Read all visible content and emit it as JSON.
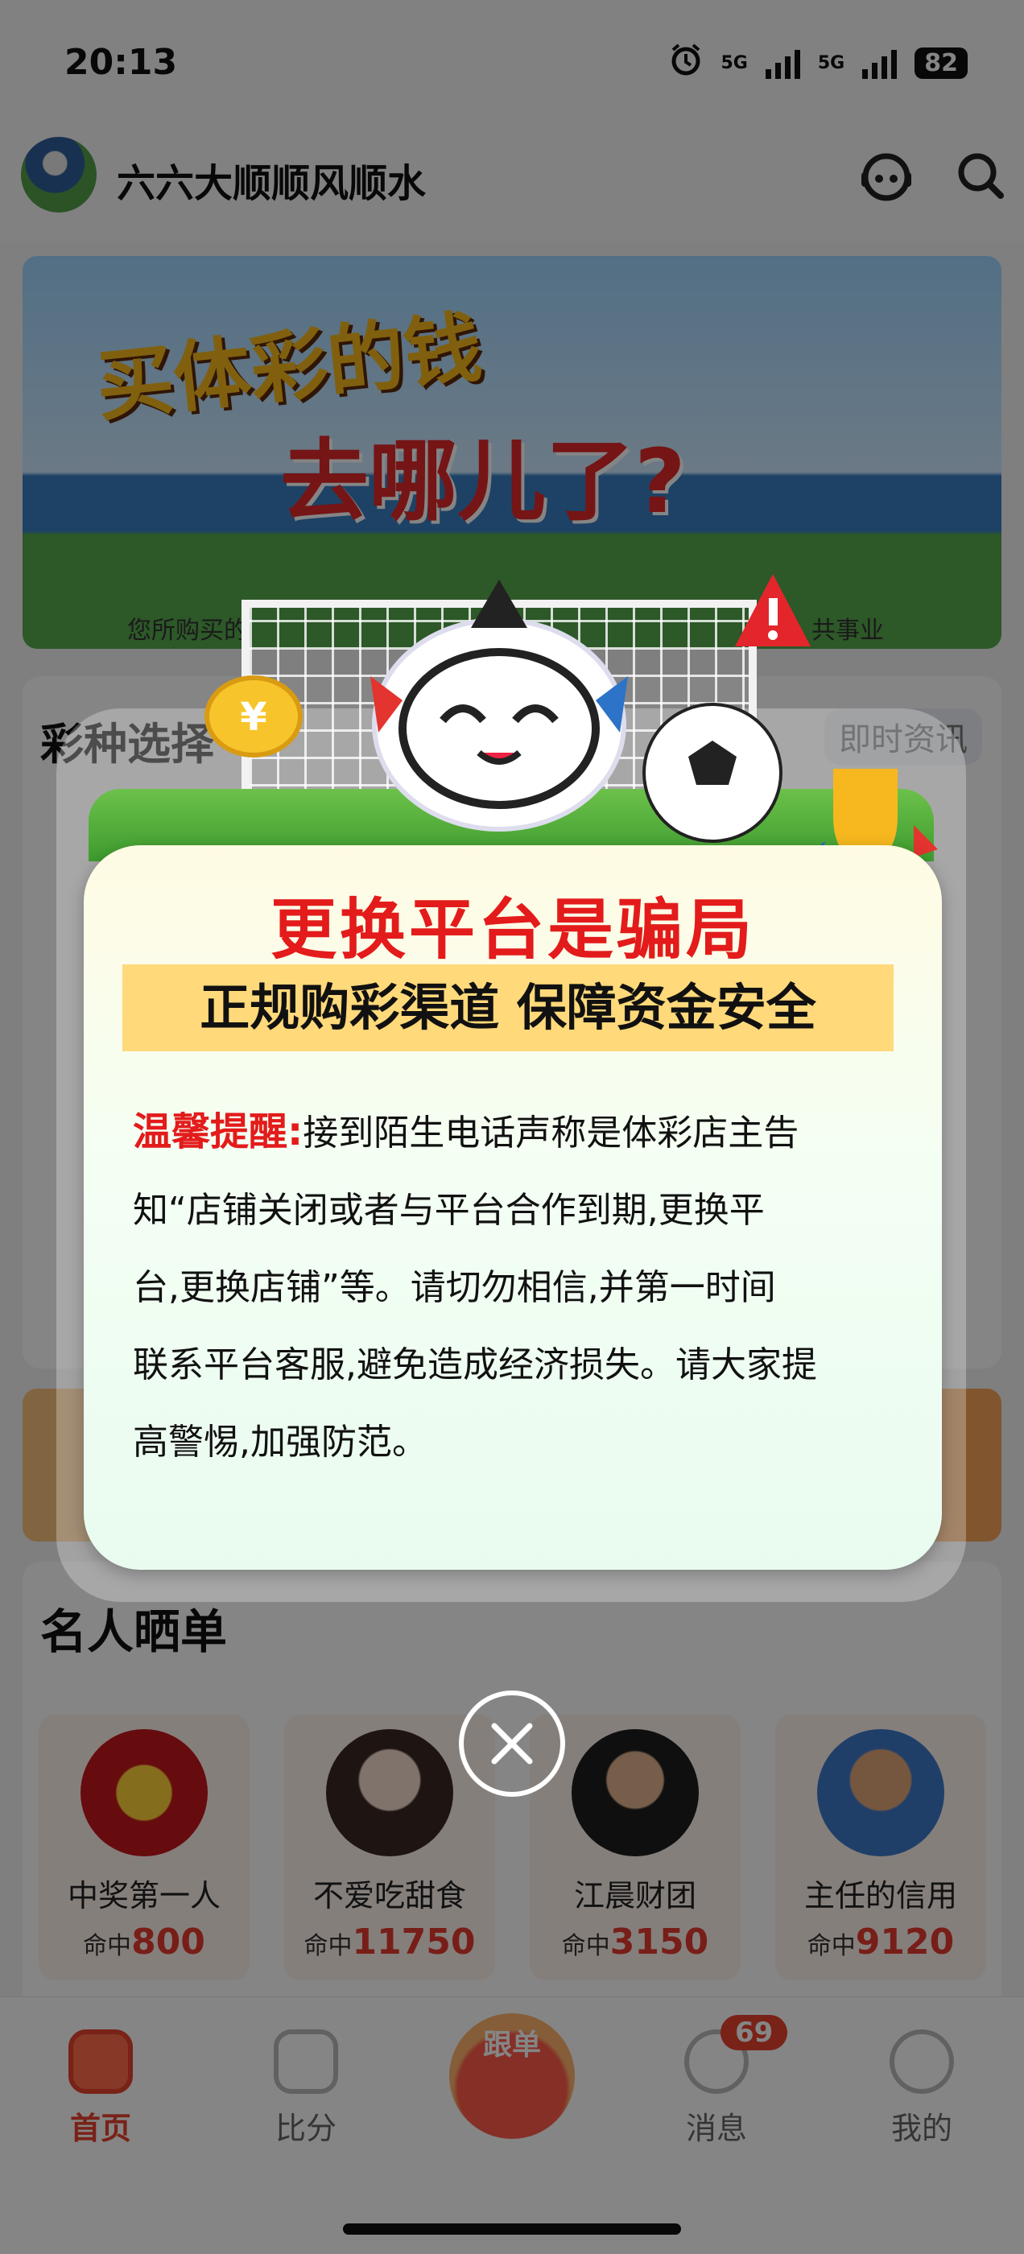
{
  "status_bar": {
    "time": "20:13",
    "signal_label_1": "5G",
    "signal_label_2": "5G",
    "battery": "82"
  },
  "header": {
    "title": "六六大顺顺风顺水"
  },
  "banner": {
    "line1": "买体彩的钱",
    "line2": "去哪儿了?",
    "caption": "您所购买的",
    "caption_right": "共事业"
  },
  "lottery_section": {
    "title": "彩种选择",
    "news_tag": "即时资讯"
  },
  "celebrity_section": {
    "title": "名人晒单",
    "hit_label": "命中",
    "items": [
      {
        "name": "中奖第一人",
        "hits": "800",
        "avatar_color": "#c4161c"
      },
      {
        "name": "不爱吃甜食",
        "hits": "11750",
        "avatar_color": "#e9e2dc"
      },
      {
        "name": "江晨财团",
        "hits": "3150",
        "avatar_color": "#2b2b2b"
      },
      {
        "name": "主任的信用",
        "hits": "9120",
        "avatar_color": "#3c79c9"
      }
    ]
  },
  "tabbar": {
    "tabs": [
      {
        "label": "首页",
        "icon": "home-icon"
      },
      {
        "label": "比分",
        "icon": "score-icon"
      },
      {
        "label": "跟单",
        "icon": "follow-icon"
      },
      {
        "label": "消息",
        "icon": "message-icon"
      },
      {
        "label": "我的",
        "icon": "profile-icon"
      }
    ],
    "message_badge": "69"
  },
  "modal": {
    "title": "更换平台是骗局",
    "subtitle": "正规购彩渠道 保障资金安全",
    "warning_label": "温馨提醒:",
    "body_line1": "接到陌生电话声称是体彩店主告",
    "body_line2": "知“店铺关闭或者与平台合作到期,更换平",
    "body_line3": "台,更换店铺”等。请切勿相信,并第一时间",
    "body_line4": "联系平台客服,避免造成经济损失。请大家提",
    "body_line5": "高警惕,加强防范。",
    "close_icon": "close-icon"
  },
  "colors": {
    "accent": "#e31b1b",
    "subtitle_bg": "#ffd97a",
    "tab_active": "#e8412f"
  }
}
